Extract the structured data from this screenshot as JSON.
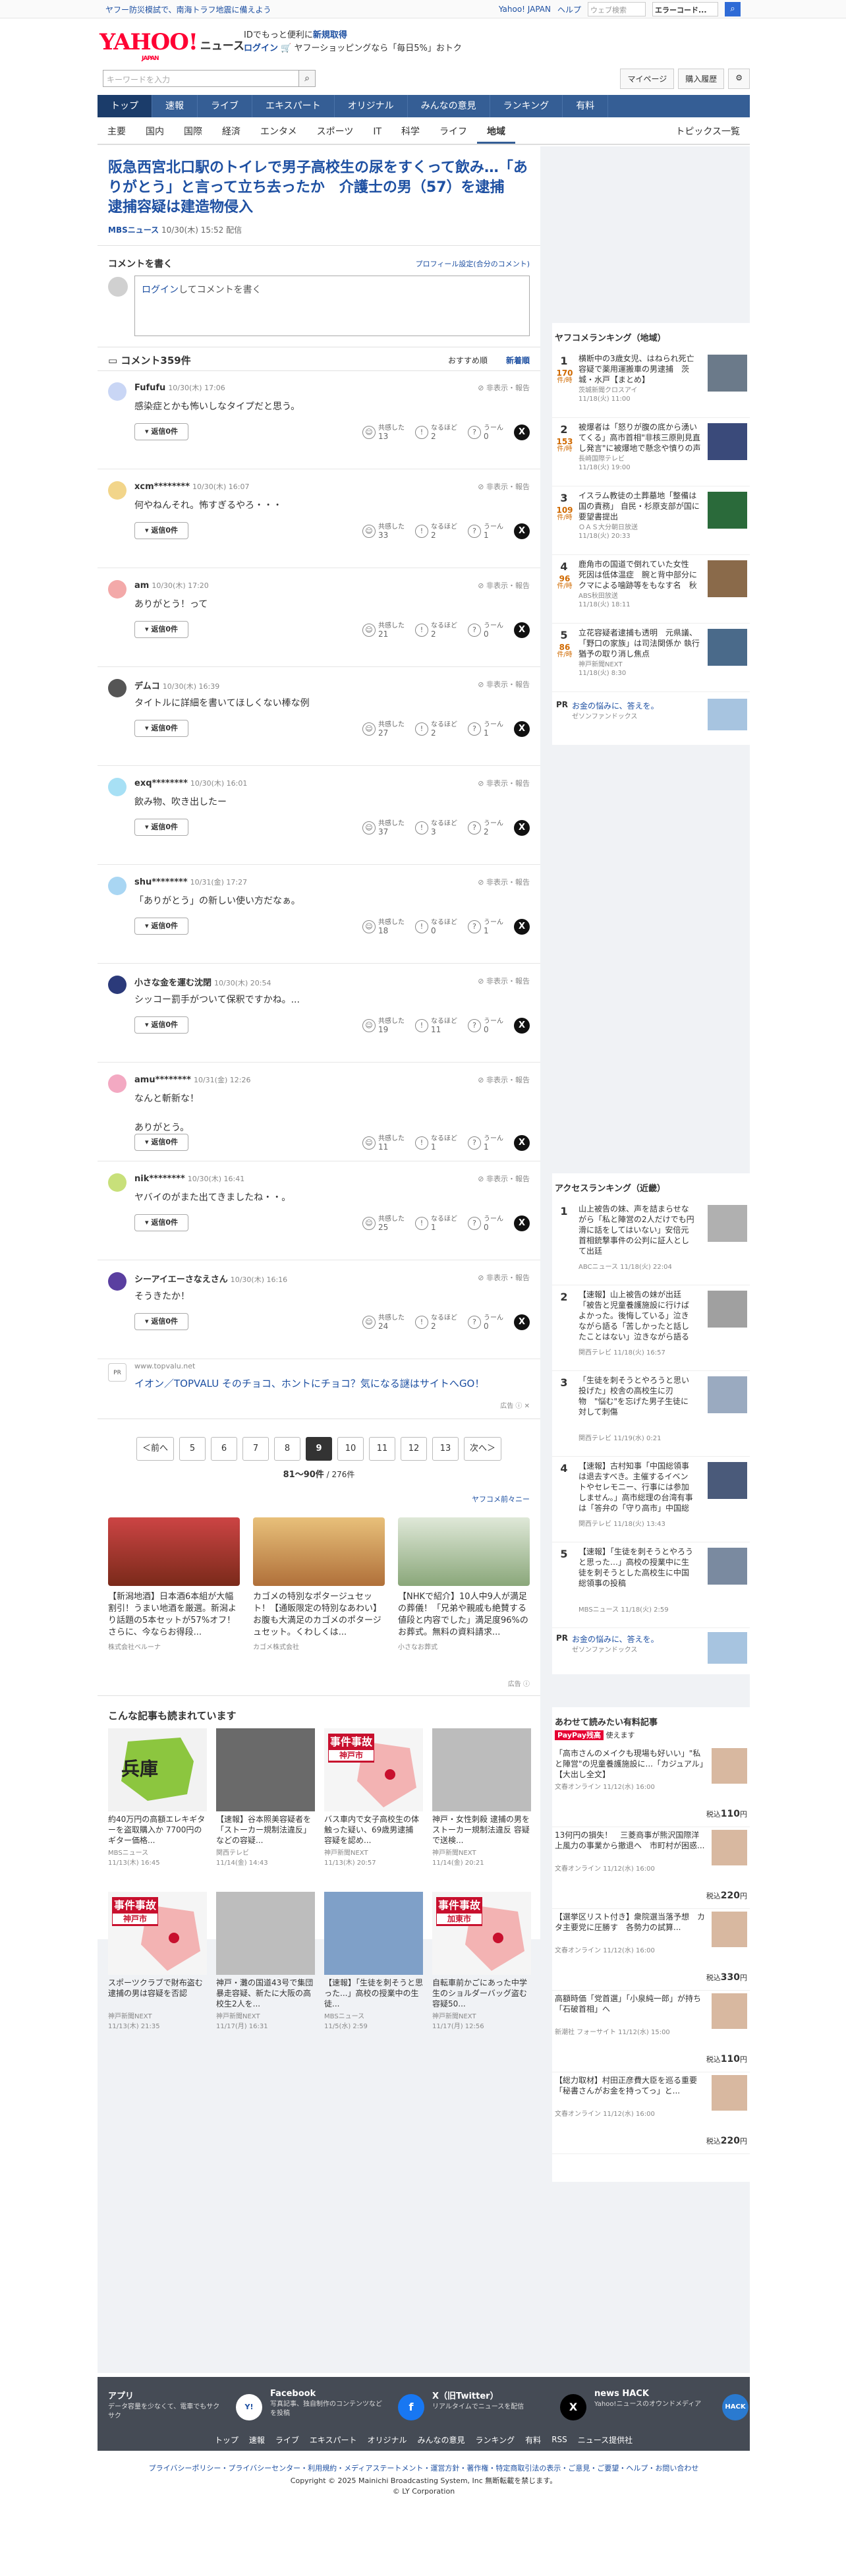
{
  "topbar": {
    "alert": "ヤフー防災模試で、南海トラフ地震に備えよう",
    "links": [
      "Yahoo! JAPAN",
      "ヘルプ"
    ],
    "web_search_placeholder": "ウェブ検索",
    "search_value": "エラーコード..."
  },
  "header": {
    "logo": "YAHOO!",
    "logo_jp": "JAPAN",
    "service": "ニュース",
    "promo1": "IDでもっと便利に",
    "promo1_b": "新規取得",
    "promo2_login": "ログイン",
    "promo2": "ヤフーショッピングなら「毎日5%」おトク"
  },
  "search": {
    "placeholder": "キーワードを入力",
    "buttons": [
      "マイページ",
      "購入履歴"
    ]
  },
  "gnav": [
    "トップ",
    "速報",
    "ライブ",
    "エキスパート",
    "オリジナル",
    "みんなの意見",
    "ランキング",
    "有料"
  ],
  "snav": [
    "主要",
    "国内",
    "国際",
    "経済",
    "エンタメ",
    "スポーツ",
    "IT",
    "科学",
    "ライフ",
    "地域"
  ],
  "snav_right": "トピックス一覧",
  "article": {
    "title": "阪急西宮北口駅のトイレで男子高校生の尿をすくって飲み…「ありがとう」と言って立ち去ったか　介護士の男（57）を逮捕　逮捕容疑は建造物侵入",
    "source": "MBSニュース",
    "date": "10/30(木) 15:52 配信"
  },
  "comment_form": {
    "heading": "コメントを書く",
    "profile_link": "プロフィール設定(合分のコメント)",
    "login": "ログイン",
    "placeholder": "してコメントを書く"
  },
  "comments_header": {
    "count": "コメント359件",
    "sort_recommended": "おすすめ順",
    "sort_new": "新着順"
  },
  "labels": {
    "report": "非表示・報告",
    "reply": "返信",
    "agree": "共感した",
    "nonaru": "なるほど",
    "uun": "うーん"
  },
  "comments": [
    {
      "name": "Fufufu",
      "date": "10/30(木) 17:06",
      "text": "感染症とかも怖いしなタイプだと思う。",
      "replies": "0件",
      "agree": "13",
      "nonaru": "2",
      "uun": "0",
      "color": "#c9d6f5"
    },
    {
      "name": "xcm********",
      "date": "10/30(木) 16:07",
      "text": "何やねんそれ。怖すぎるやろ・・・",
      "replies": "0件",
      "agree": "33",
      "nonaru": "2",
      "uun": "1",
      "color": "#f2d58a"
    },
    {
      "name": "am",
      "date": "10/30(木) 17:20",
      "text": "ありがとう！って",
      "replies": "0件",
      "agree": "21",
      "nonaru": "2",
      "uun": "0",
      "color": "#f3a9a9"
    },
    {
      "name": "デムコ",
      "date": "10/30(木) 16:39",
      "text": "タイトルに詳細を書いてほしくない棒な例",
      "replies": "0件",
      "agree": "27",
      "nonaru": "2",
      "uun": "1",
      "color": "#555555"
    },
    {
      "name": "exq********",
      "date": "10/30(木) 16:01",
      "text": "飲み物、吹き出したー",
      "replies": "0件",
      "agree": "37",
      "nonaru": "3",
      "uun": "2",
      "color": "#a7e0f5"
    },
    {
      "name": "shu********",
      "date": "10/31(金) 17:27",
      "text": "「ありがとう」の新しい使い方だなぁ。",
      "replies": "0件",
      "agree": "18",
      "nonaru": "0",
      "uun": "1",
      "color": "#a9d6f3"
    },
    {
      "name": "小さな金を運む沈閉",
      "date": "10/30(木) 20:54",
      "text": "シッコー罰手がついて保釈ですかね。...",
      "replies": "0件",
      "agree": "19",
      "nonaru": "11",
      "uun": "0",
      "color": "#2b3a7a"
    },
    {
      "name": "amu********",
      "date": "10/31(金) 12:26",
      "text": "なんと斬新な！\n\nありがとう。",
      "replies": "0件",
      "agree": "11",
      "nonaru": "1",
      "uun": "1",
      "color": "#f3a9c2"
    },
    {
      "name": "nik********",
      "date": "10/30(木) 16:41",
      "text": "ヤバイのがまた出てきましたね・・。",
      "replies": "0件",
      "agree": "25",
      "nonaru": "1",
      "uun": "0",
      "color": "#c8e07a"
    },
    {
      "name": "シーアイエーさなえさん",
      "date": "10/30(木) 16:16",
      "text": "そうきたか！",
      "replies": "0件",
      "agree": "24",
      "nonaru": "2",
      "uun": "0",
      "color": "#5a3fa0"
    }
  ],
  "ad1": {
    "logo": "PR",
    "domain": "www.topvalu.net",
    "title": "イオン／TOPVALU そのチョコ、ホントにチョコ？気になる謎はサイトへGO！",
    "mark": "広告"
  },
  "pager": {
    "prev": "＜前へ",
    "pages": [
      "5",
      "6",
      "7",
      "8",
      "9",
      "10",
      "11",
      "12",
      "13"
    ],
    "current": "9",
    "next": "次へ＞",
    "info_range": "81〜90件",
    "info_total": "/ 276件"
  },
  "gad_header": "ヤフコメ前々ニー",
  "gads": [
    {
      "title": "【新潟地酒】日本酒6本組が大幅割引！うまい地酒を厳選。新潟より話題の5本セットが57%オフ！さらに、今ならお得段...",
      "sponsor": "株式会社ベルーナ",
      "color": "#a23a2a"
    },
    {
      "title": "カゴメの特別なポタージュセット！【通販限定の特別なあわい】お腹も大満足のカゴメのポタージュセット。くわしくは...",
      "sponsor": "カゴメ株式会社",
      "color": "#d9a86a"
    },
    {
      "title": "【NHKで紹介】10人中9人が満足の葬儀！「兄弟や親戚も絶賛する値段と内容でした」満足度96%のお葬式。無料の資料請求...",
      "sponsor": "小さなお葬式",
      "color": "#8aa77a"
    }
  ],
  "gad_mark": "広告",
  "related_heading": "こんな記事も読まれています",
  "related": [
    {
      "title": "約40万円の高額エレキギターを盗取購入か 7700円のギター価格...",
      "source": "MBSニュース",
      "date": "11/13(木) 16:45",
      "tag": "兵庫",
      "kind": "map"
    },
    {
      "title": "【速報】谷本照美容疑者を「ストーカー規制法違反」などの容疑...",
      "source": "関西テレビ",
      "date": "11/14(金) 14:43",
      "kind": "photo",
      "color": "#6a6a6a"
    },
    {
      "title": "バス車内で女子高校生の体触った疑い、69歳男逮捕 容疑を認め...",
      "source": "神戸新聞NEXT",
      "date": "11/13(木) 20:57",
      "tag": "事件事故",
      "sub": "神戸市",
      "kind": "tag"
    },
    {
      "title": "神戸・女性刺殺 逮捕の男をストーカー規制法違反 容疑で送検...",
      "source": "神戸新聞NEXT",
      "date": "11/14(金) 20:21",
      "kind": "photo",
      "color": "#bcbcbc"
    },
    {
      "title": "スポーツクラブで財布盗む 逮捕の男は容疑を否認",
      "source": "神戸新聞NEXT",
      "date": "11/13(木) 21:35",
      "tag": "事件事故",
      "sub": "神戸市",
      "kind": "tag"
    },
    {
      "title": "神戸・灘の国道43号で集団暴走容疑、新たに大阪の高校生2人を...",
      "source": "神戸新聞NEXT",
      "date": "11/17(月) 16:31",
      "kind": "photo",
      "color": "#bdbdbd"
    },
    {
      "title": "【速報】「生徒を刺そうと思った...」高校の授業中の生徒...",
      "source": "MBSニュース",
      "date": "11/5(水) 2:59",
      "kind": "photo",
      "color": "#7fa0c8"
    },
    {
      "title": "自転車前かごにあった中学生のショルダーバッグ盗む 容疑50...",
      "source": "神戸新聞NEXT",
      "date": "11/17(月) 12:56",
      "tag": "事件事故",
      "sub": "加東市",
      "kind": "tag"
    }
  ],
  "ranking_local": {
    "heading": "ヤフコメランキング（地域）",
    "items": [
      {
        "n": "1",
        "count": "170",
        "unit": "件/時",
        "title": "横断中の3歳女児、はねられ死亡　容疑で薬用運搬車の男逮捕　茨城・水戸【まとめ】",
        "source": "茨城新聞クロスアイ",
        "date": "11/18(火) 11:00",
        "color": "#6b7a8a"
      },
      {
        "n": "2",
        "count": "153",
        "unit": "件/時",
        "title": "被爆者は「怒りが腹の底から湧いてくる」高市首相\"非核三原則見直し発言\"に被爆地で懸念や憤りの声【長崎】",
        "source": "長崎国際テレビ",
        "date": "11/18(火) 19:00",
        "color": "#3a4a7a"
      },
      {
        "n": "3",
        "count": "109",
        "unit": "件/時",
        "title": "イスラム教徒の土葬墓地「整備は国の責務」 自民・杉原支部が国に要望書提出",
        "source": "ＯＡＳ大分朝日放送",
        "date": "11/18(火) 20:33",
        "color": "#2a6a3a"
      },
      {
        "n": "4",
        "count": "96",
        "unit": "件/時",
        "title": "鹿角市の国道で倒れていた女性　死因は低体温症　腕と背中部分にクマによる噛跡等をもなす名　秋田",
        "source": "ABS秋田放送",
        "date": "11/18(火) 18:11",
        "color": "#8a6a4a"
      },
      {
        "n": "5",
        "count": "86",
        "unit": "件/時",
        "title": "立花容疑者逮捕も透明　元県議、「野口の家族」は司法関係か 執行猶予の取り消し焦点",
        "source": "神戸新聞NEXT",
        "date": "11/18(火) 8:30",
        "color": "#4a6a8a"
      }
    ]
  },
  "pr_side": {
    "label": "PR",
    "title": "お金の悩みに、答えを。",
    "sponsor": "ゼソンファンドックス"
  },
  "ranking_access": {
    "heading": "アクセスランキング（近畿）",
    "items": [
      {
        "n": "1",
        "title": "山上被告の妹、声を詰まらせながら「私と陣営の2人だけでも円滑に話をしてはいない」安倍元首相銃撃事件の公判に証人として出廷",
        "source": "ABCニュース",
        "date": "11/18(火) 22:04",
        "color": "#b0b0b0"
      },
      {
        "n": "2",
        "title": "【速報】山上被告の妹が出廷「被告と児童養護施設に行けばよかった。後悔している」泣きながら語る「苦しかったと話したことはない」泣きながら語る「苦しかったことはない」",
        "source": "関西テレビ",
        "date": "11/18(火) 16:57",
        "color": "#a0a0a0"
      },
      {
        "n": "3",
        "title": "「生徒を刺そうとやろうと思い投げた」校舎の高校生に刃物　\"悩む\"を忘げた男子生徒に対して刺傷",
        "source": "関西テレビ",
        "date": "11/19(水) 0:21",
        "color": "#9aaac0"
      },
      {
        "n": "4",
        "title": "【速報】古村知事「中国総領事は退去すべき。主催するイベントやセレモニー、行事には参加しません。」高市総理の台湾有事は「答弁の「守り高市」中国総領事の投稿",
        "source": "関西テレビ",
        "date": "11/18(火) 13:43",
        "color": "#4a5a7a"
      },
      {
        "n": "5",
        "title": "【速報】「生徒を刺そうとやろうと思った…」高校の授業中に生徒を刺そうとした高校生に中国総領事の投稿",
        "source": "MBSニュース",
        "date": "11/18(火) 2:59",
        "color": "#7a8aa0"
      }
    ]
  },
  "paid": {
    "heading": "あわせて読みたい有料記事",
    "badge": "PayPay残高",
    "badge_sub": "使えます",
    "items": [
      {
        "title": "「高市さんのメイクも現場も好いい」\"私と陣営\"の児童養護施設に...「カジュアル」【大出し全文】",
        "source": "文春オンライン",
        "date": "11/12(水) 16:00",
        "price": "110"
      },
      {
        "title": "13何円の損失！　三菱商事が熊沢国際洋上風力の事業から撤退へ　市町村が困惑...",
        "source": "文春オンライン",
        "date": "11/12(水) 16:00",
        "price": "220"
      },
      {
        "title": "【選挙区リスト付き】衆院選当落予想　カタ主要党に圧勝す　各勢力の試算...",
        "source": "文春オンライン",
        "date": "11/12(水) 16:00",
        "price": "330"
      },
      {
        "title": "高額時価「党首選」「小泉純一郎」が持ち「石破首相」へ",
        "source": "新潮社 フォーサイト",
        "date": "11/12(水) 15:00",
        "price": "110"
      },
      {
        "title": "【総力取材】村田正彦費大臣を巡る重要「秘書さんがお金を持ってっ」と...",
        "source": "文春オンライン",
        "date": "11/12(水) 16:00",
        "price": "220"
      }
    ]
  },
  "footer": {
    "items": [
      {
        "t": "アプリ",
        "d": "データ容量を少なくて、電車でもサクサク"
      },
      {
        "t": "Facebook",
        "d": "写真記事、独自制作のコンテンツなどを投稿"
      },
      {
        "t": "X（旧Twitter）",
        "d": "リアルタイムでニュースを配信"
      },
      {
        "t": "news HACK",
        "d": "Yahoo!ニュースのオウンドメディア"
      }
    ],
    "nav": [
      "トップ",
      "速報",
      "ライブ",
      "エキスパート",
      "オリジナル",
      "みんなの意見",
      "ランキング",
      "有料",
      "RSS",
      "ニュース提供社"
    ],
    "links": "プライバシーポリシー・プライバシーセンター・利用規約・メディアステートメント・運営方針・著作権・特定商取引法の表示・ご意見・ご要望・ヘルプ・お問い合わせ",
    "copy1": "Copyright © 2025 Mainichi Broadcasting System, Inc 無断転載を禁じます。",
    "copy2": "© LY Corporation"
  }
}
